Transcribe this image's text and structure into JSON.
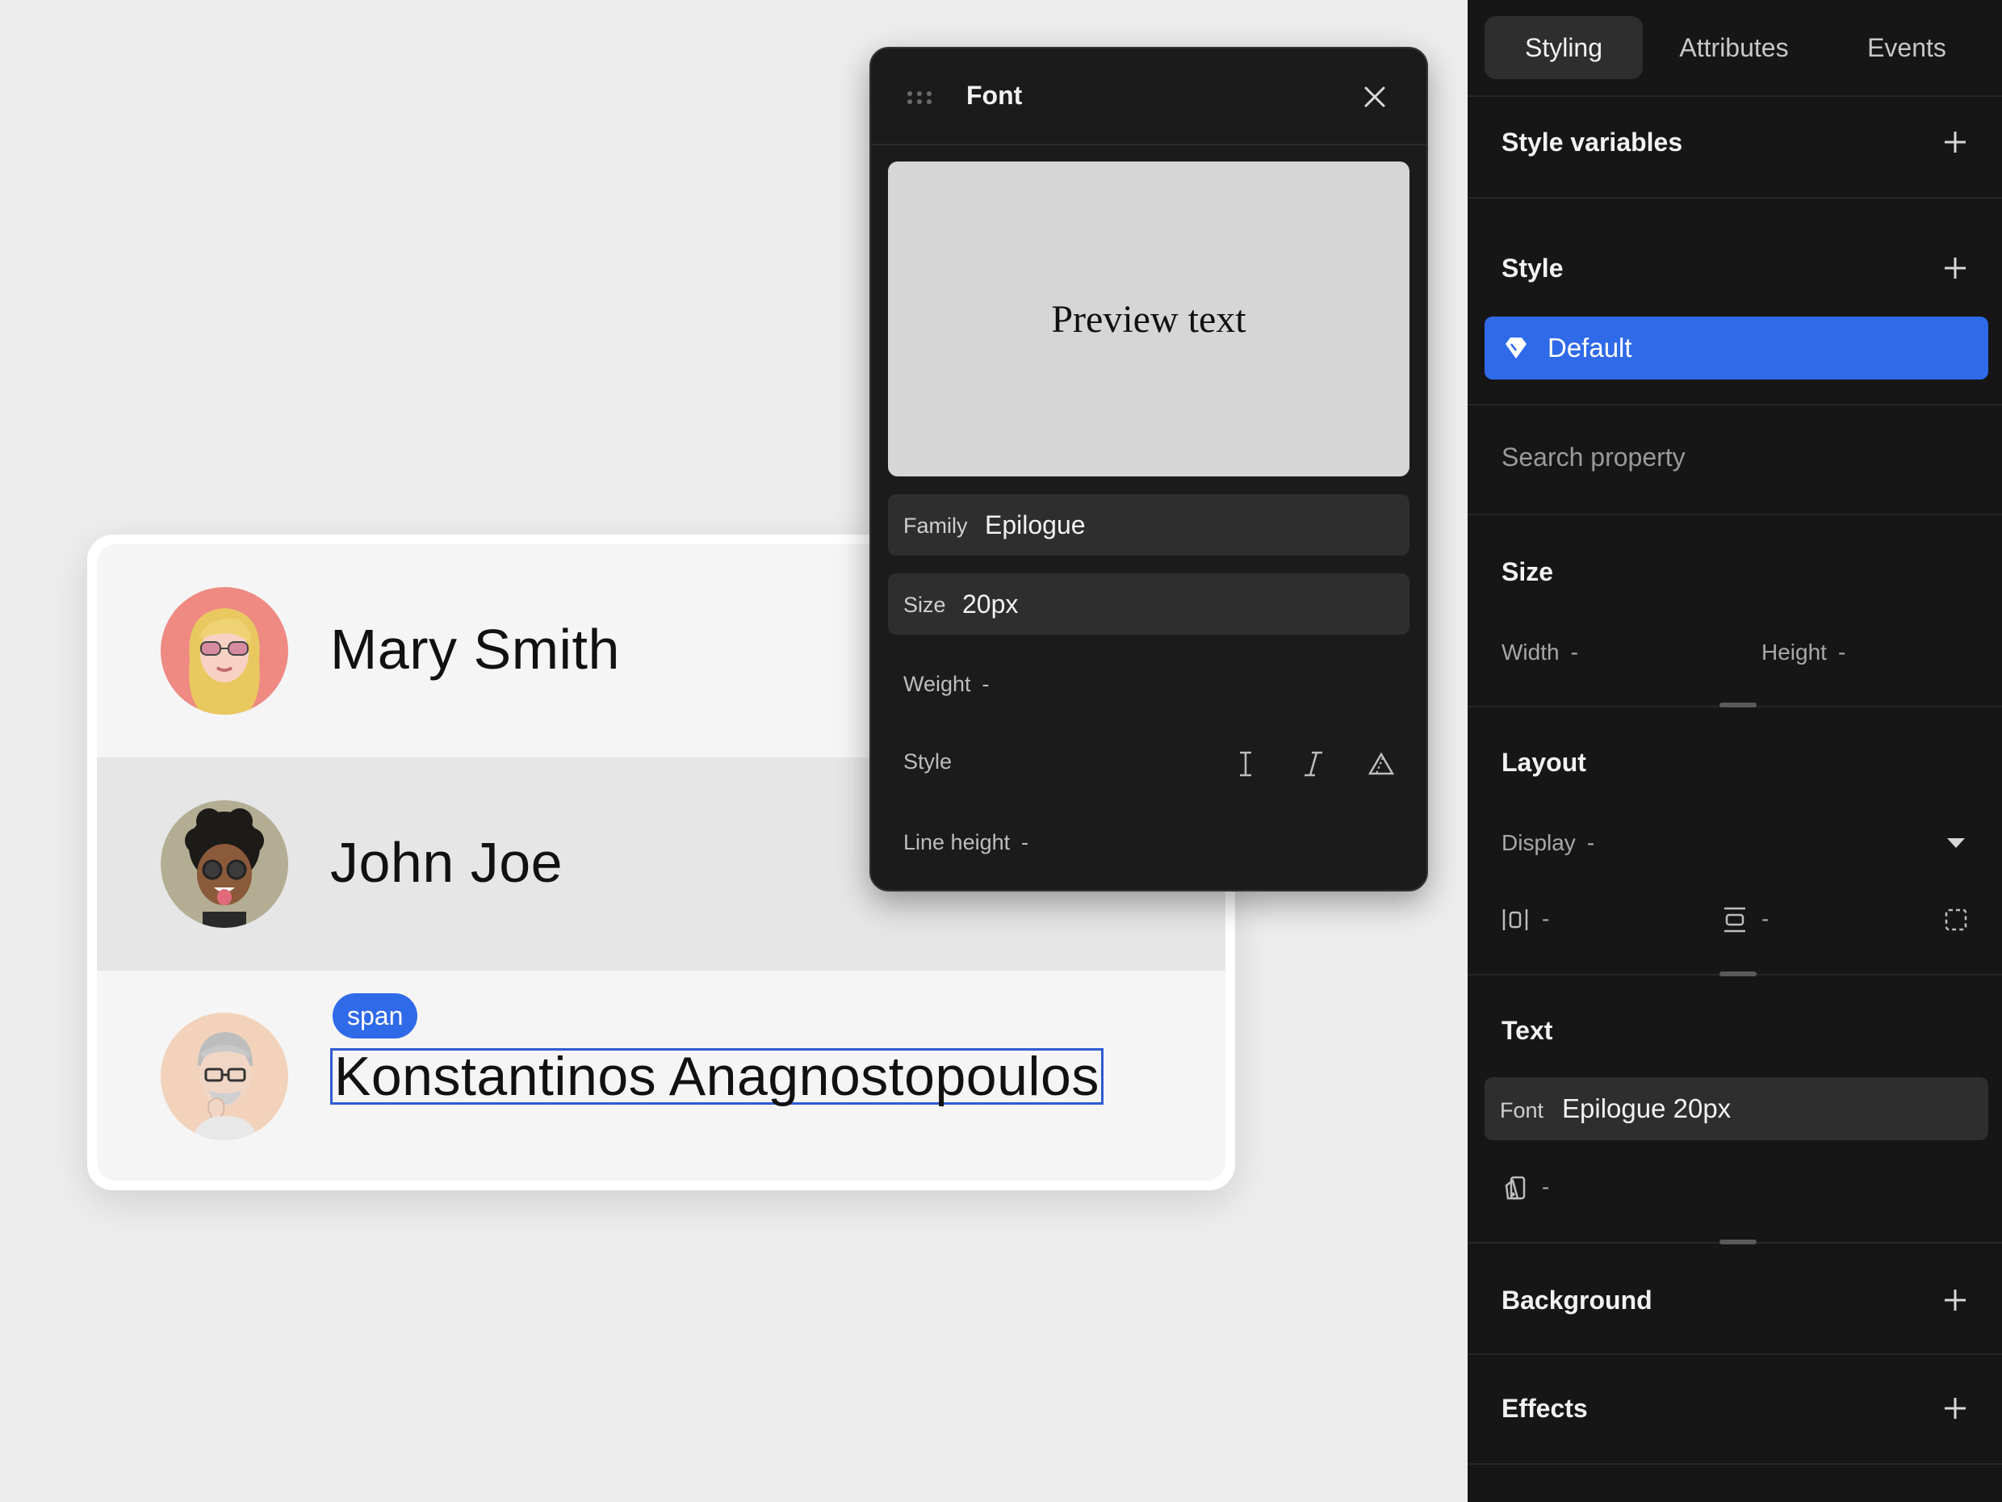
{
  "canvas": {
    "rows": [
      {
        "name": "Mary Smith",
        "avatar": "blonde-woman-avatar"
      },
      {
        "name": "John Joe",
        "avatar": "curly-hair-man-avatar"
      },
      {
        "name": "Konstantinos Anagnostopoulos",
        "avatar": "thinking-grey-man-avatar",
        "tag": "span"
      }
    ]
  },
  "font_panel": {
    "title": "Font",
    "preview_text": "Preview text",
    "family_label": "Family",
    "family_value": "Epilogue",
    "size_label": "Size",
    "size_value": "20px",
    "weight_label": "Weight",
    "weight_value": "-",
    "style_label": "Style",
    "style_icons": [
      "text-cursor-icon",
      "italic-icon",
      "oblique-icon"
    ],
    "line_height_label": "Line height",
    "line_height_value": "-"
  },
  "inspector": {
    "tabs": [
      {
        "label": "Styling",
        "active": true
      },
      {
        "label": "Attributes",
        "active": false
      },
      {
        "label": "Events",
        "active": false
      }
    ],
    "style_variables": {
      "title": "Style variables"
    },
    "style": {
      "title": "Style",
      "selected": "Default"
    },
    "search": {
      "placeholder": "Search property"
    },
    "size": {
      "title": "Size",
      "width_label": "Width",
      "width_value": "-",
      "height_label": "Height",
      "height_value": "-"
    },
    "layout": {
      "title": "Layout",
      "display_label": "Display",
      "display_value": "-",
      "gap_value": "-",
      "align_value": "-"
    },
    "text": {
      "title": "Text",
      "font_label": "Font",
      "font_value": "Epilogue 20px",
      "extra_value": "-"
    },
    "background": {
      "title": "Background"
    },
    "effects": {
      "title": "Effects"
    }
  },
  "colors": {
    "accent": "#2f6ae8",
    "panel_bg": "#161616",
    "canvas_bg": "#ededed",
    "selection": "#2f5bd3"
  }
}
